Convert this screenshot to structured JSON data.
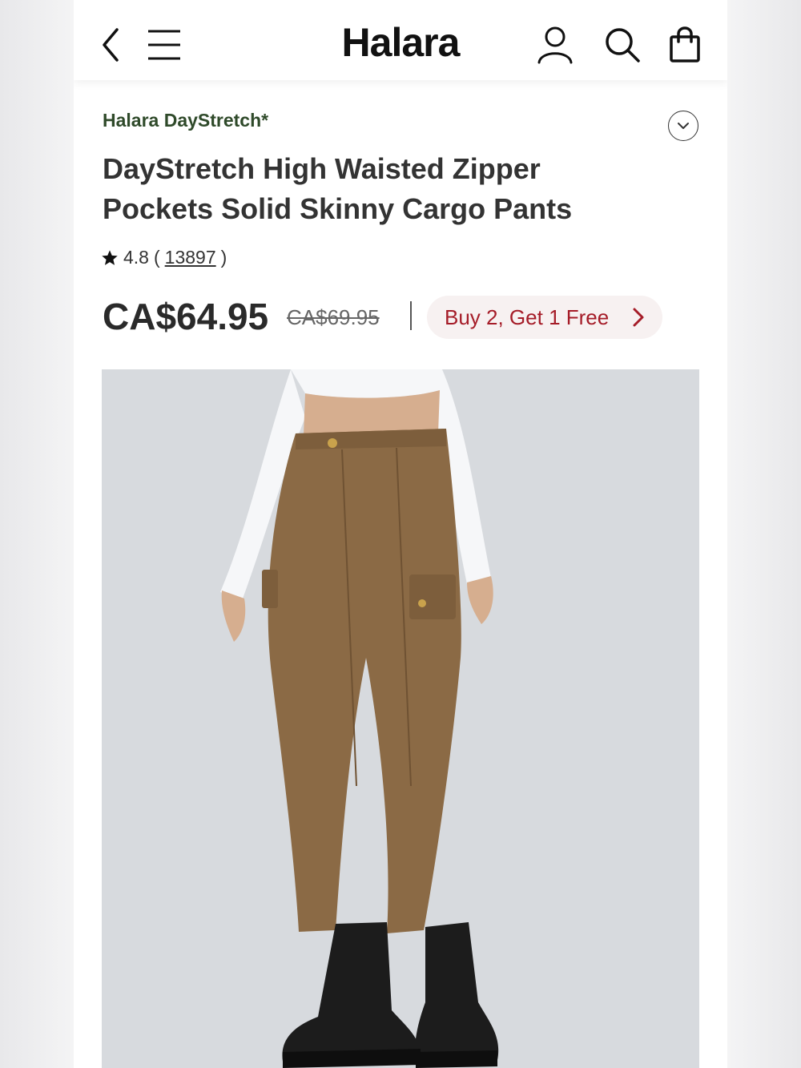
{
  "header": {
    "logo": "Halara",
    "back_icon": "chevron-left-icon",
    "menu_icon": "hamburger-menu-icon",
    "account_icon": "user-icon",
    "search_icon": "search-icon",
    "bag_icon": "shopping-bag-icon"
  },
  "product": {
    "brand": "Halara DayStretch*",
    "title": "DayStretch High Waisted Zipper Pockets Solid Skinny Cargo Pants",
    "rating": "4.8",
    "review_count": "13897",
    "price": "CA$64.95",
    "original_price": "CA$69.95",
    "promo": "Buy 2, Get 1 Free"
  },
  "colors": {
    "brand_green": "#2f4a2a",
    "promo_red": "#a51c28",
    "promo_bg": "#f7f1f1",
    "pants_brown": "#8b6a45"
  }
}
